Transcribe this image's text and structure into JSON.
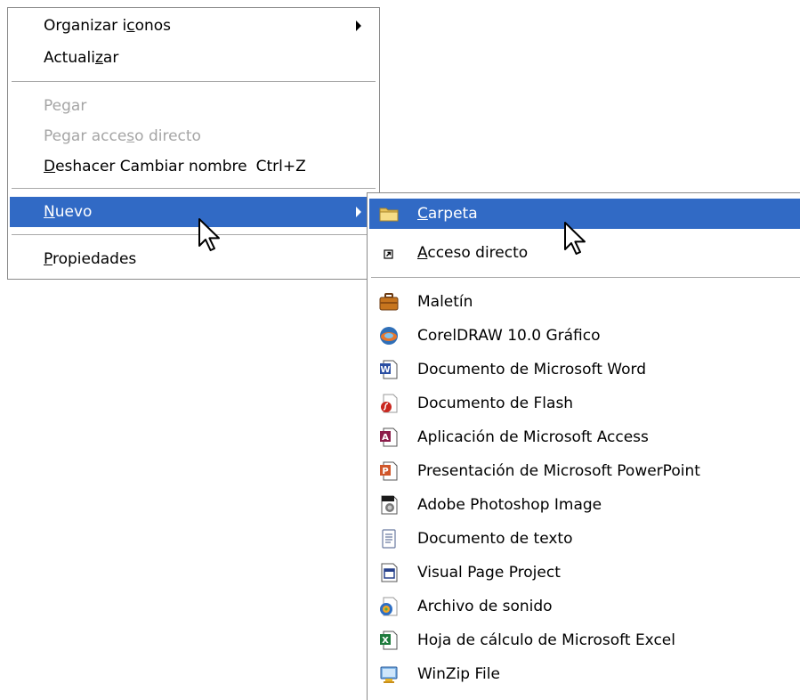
{
  "context_menu": {
    "items": [
      {
        "pre": "Organizar i",
        "ul": "c",
        "post": "onos"
      },
      {
        "pre": "Actuali",
        "ul": "z",
        "post": "ar"
      },
      {
        "pre": "Pe",
        "ul": "g",
        "post": "ar"
      },
      {
        "pre": "Pegar acce",
        "ul": "s",
        "post": "o directo"
      },
      {
        "pre": "",
        "ul": "D",
        "post": "eshacer Cambiar nombre",
        "shortcut": "Ctrl+Z"
      },
      {
        "pre": "",
        "ul": "N",
        "post": "uevo"
      },
      {
        "pre": "",
        "ul": "P",
        "post": "ropiedades"
      }
    ]
  },
  "submenu": {
    "items": [
      {
        "pre": "",
        "ul": "C",
        "post": "arpeta",
        "icon": "folder-icon"
      },
      {
        "pre": "",
        "ul": "A",
        "post": "cceso directo",
        "icon": "shortcut-icon"
      },
      {
        "label": "Maletín",
        "icon": "briefcase-icon"
      },
      {
        "label": "CorelDRAW 10.0 Gráfico",
        "icon": "coreldraw-icon"
      },
      {
        "label": "Documento de Microsoft Word",
        "icon": "word-icon"
      },
      {
        "label": "Documento de Flash",
        "icon": "flash-icon"
      },
      {
        "label": "Aplicación de Microsoft Access",
        "icon": "access-icon"
      },
      {
        "label": "Presentación de Microsoft PowerPoint",
        "icon": "powerpoint-icon"
      },
      {
        "label": "Adobe Photoshop Image",
        "icon": "photoshop-icon"
      },
      {
        "label": "Documento de texto",
        "icon": "text-document-icon"
      },
      {
        "label": "Visual Page Project",
        "icon": "visual-page-icon"
      },
      {
        "label": "Archivo de sonido",
        "icon": "sound-file-icon"
      },
      {
        "label": "Hoja de cálculo de Microsoft Excel",
        "icon": "excel-icon"
      },
      {
        "label": "WinZip File",
        "icon": "winzip-icon"
      }
    ]
  },
  "colors": {
    "selection": "#316ac5",
    "disabled_text": "#a5a5a5",
    "separator": "#a8a8a8"
  }
}
